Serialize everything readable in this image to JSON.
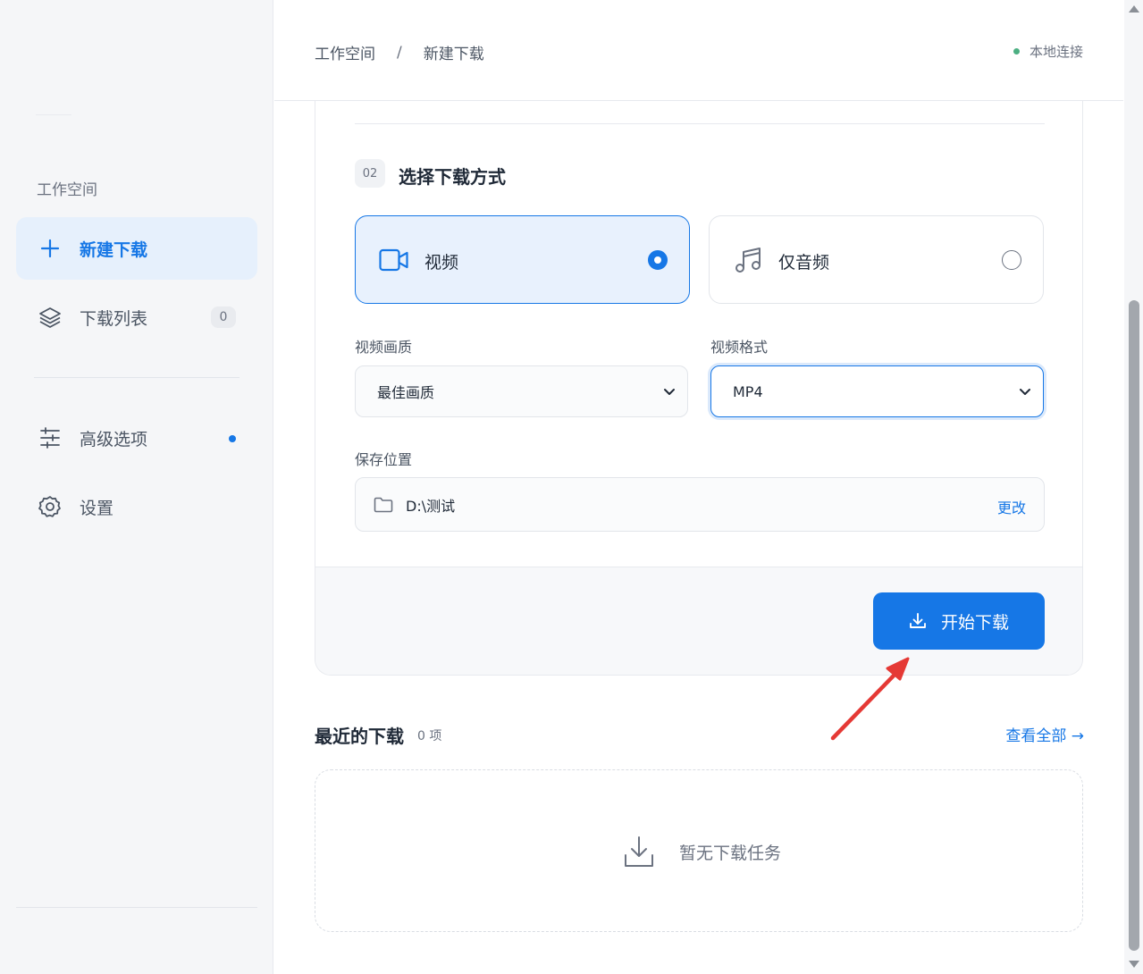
{
  "header": {
    "breadcrumb": [
      "工作空间",
      "新建下载"
    ],
    "breadcrumb_sep": "/",
    "connection_status": "本地连接",
    "connection_color": "#4caf82"
  },
  "sidebar": {
    "section_label": "工作空间",
    "items": [
      {
        "label": "新建下载",
        "icon": "plus-icon",
        "active": true
      },
      {
        "label": "下载列表",
        "icon": "layers-icon",
        "badge": "0"
      },
      {
        "label": "高级选项",
        "icon": "sliders-icon",
        "dot": true
      },
      {
        "label": "设置",
        "icon": "gear-icon"
      }
    ]
  },
  "step": {
    "number": "02",
    "title": "选择下载方式"
  },
  "modes": [
    {
      "label": "视频",
      "icon": "video-camera-icon",
      "selected": true
    },
    {
      "label": "仅音频",
      "icon": "music-note-icon",
      "selected": false
    }
  ],
  "quality": {
    "label": "视频画质",
    "value": "最佳画质"
  },
  "format": {
    "label": "视频格式",
    "value": "MP4"
  },
  "save": {
    "label": "保存位置",
    "path": "D:\\测试",
    "change_label": "更改"
  },
  "start_button": "开始下载",
  "recent": {
    "title": "最近的下载",
    "count": "0 项",
    "view_all": "查看全部 →",
    "empty_text": "暂无下载任务"
  },
  "colors": {
    "accent": "#1677e6",
    "selected_bg": "#e8f1fd",
    "annotation_arrow": "#e53935"
  }
}
